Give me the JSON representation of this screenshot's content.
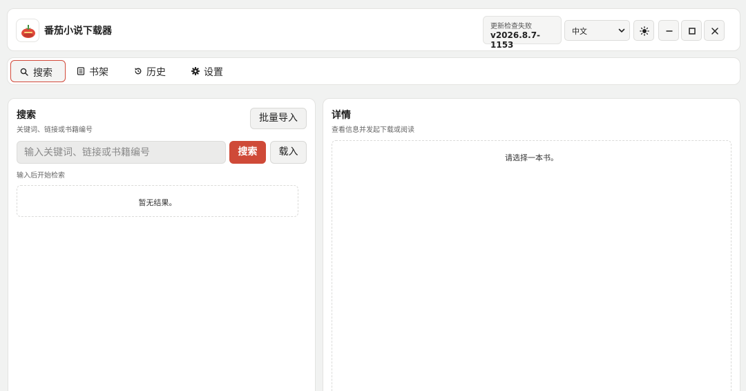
{
  "app": {
    "title": "番茄小说下载器",
    "accent_color": "#cf4a38",
    "icon": "tomato-icon"
  },
  "version": {
    "status": "更新检查失败",
    "number": "v2026.8.7-1153"
  },
  "language": {
    "selected": "中文"
  },
  "window_controls": {
    "theme_icon": "sun-icon",
    "minimize_icon": "minimize-icon",
    "maximize_icon": "maximize-icon",
    "close_icon": "close-icon"
  },
  "tabs": [
    {
      "label": "搜索",
      "icon": "search-icon",
      "active": true
    },
    {
      "label": "书架",
      "icon": "bookshelf-icon",
      "active": false
    },
    {
      "label": "历史",
      "icon": "history-icon",
      "active": false
    },
    {
      "label": "设置",
      "icon": "gear-icon",
      "active": false
    }
  ],
  "search_panel": {
    "title": "搜索",
    "subtitle": "关键词、链接或书籍编号",
    "batch_import_label": "批量导入",
    "input_placeholder": "输入关键词、链接或书籍编号",
    "input_value": "",
    "search_label": "搜索",
    "load_label": "载入",
    "hint": "输入后开始检索",
    "empty_results": "暂无结果。"
  },
  "detail_panel": {
    "title": "详情",
    "subtitle": "查看信息并发起下载或阅读",
    "empty": "请选择一本书。"
  }
}
